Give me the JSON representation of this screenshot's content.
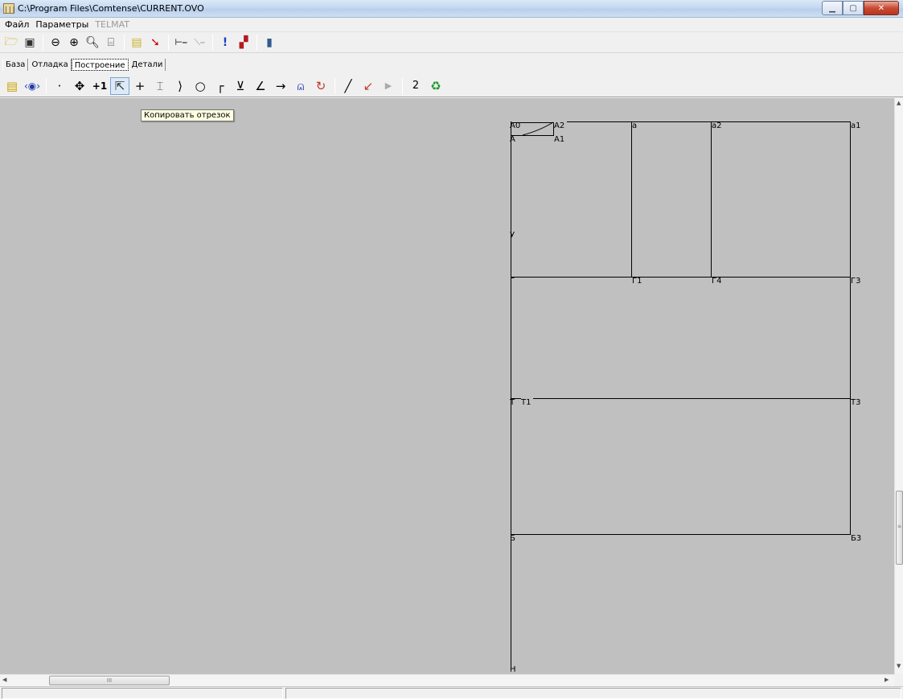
{
  "window": {
    "title": "C:\\Program Files\\Comtense\\CURRENT.OVO",
    "app_icon_text": "|||"
  },
  "menu": [
    {
      "label": "Файл",
      "enabled": true
    },
    {
      "label": "Параметры",
      "enabled": true
    },
    {
      "label": "TELMAT",
      "enabled": false
    }
  ],
  "toolbar1": {
    "icons": [
      "open-folder-icon",
      "save-disk-icon",
      "zoom-out-icon",
      "zoom-in-icon",
      "zoom-icon",
      "fit-window-icon",
      "page-icon",
      "arrow-tool-icon",
      "measure-icon",
      "measure-angle-icon",
      "exclamation-icon",
      "color-palette-icon",
      "exit-door-icon"
    ]
  },
  "tabs": [
    {
      "label": "База",
      "active": false
    },
    {
      "label": "Отладка",
      "active": false
    },
    {
      "label": "Построение",
      "active": true
    },
    {
      "label": "Детали",
      "active": false
    }
  ],
  "toolbar2": {
    "icons": [
      "notes-icon",
      "eye-icon",
      "dot-icon",
      "move-icon",
      "plus-one-icon",
      "copy-segment-icon",
      "cross-icon",
      "split-icon",
      "arc-right-icon",
      "circle-point-icon",
      "corner-icon",
      "bisector-icon",
      "angle-icon",
      "arrow-right-icon",
      "curve-icon",
      "circle-arrow-icon",
      "line-icon",
      "arc-curve-icon",
      "play-icon",
      "number-two-icon",
      "recycle-icon"
    ],
    "plus_one_label": "+1",
    "two_label": "2",
    "active_tool": "copy-segment-icon"
  },
  "tooltip": "Копировать отрезок",
  "drawing": {
    "labels": {
      "A0": "А0",
      "A2": "А2",
      "A": "А",
      "A1": "А1",
      "a": "а",
      "a2": "а2",
      "a1": "а1",
      "U": "У",
      "G": "Г",
      "G1": "Г1",
      "G4": "Г4",
      "G3": "Г3",
      "T": "Т",
      "T1": "Т1",
      "T3": "Т3",
      "B": "Б",
      "B3": "Б3",
      "N": "Н"
    }
  },
  "scrollbar": {
    "h_thumb_grip": "III",
    "v_thumb_grip": "≡"
  }
}
